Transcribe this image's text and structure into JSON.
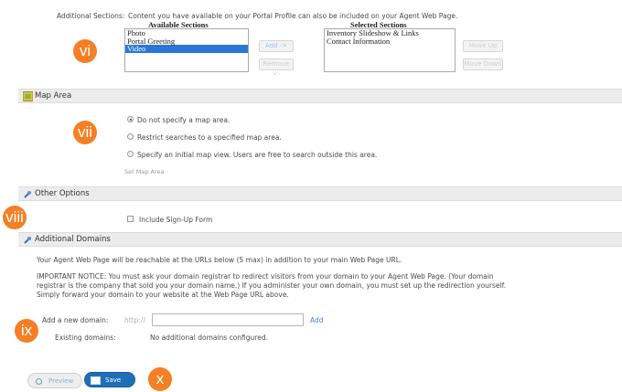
{
  "additional_sections": {
    "label": "Additional Sections:",
    "description": "Content you have available on your Portal Profile can also be included on your Agent Web Page.",
    "available_header": "Available Sections",
    "selected_header": "Selected Sections",
    "available_items": [
      "Photo",
      "Portal Greeting",
      "Video"
    ],
    "selected_items": [
      "Inventory Slideshow & Links",
      "Contact Information"
    ],
    "add_button": "Add ->",
    "remove_button": "Remove <-",
    "move_up_button": "Move Up",
    "move_down_button": "Move Down"
  },
  "map_area": {
    "title": "Map Area",
    "options": [
      "Do not specify a map area.",
      "Restrict searches to a specified map area.",
      "Specify an initial map view. Users are free to search outside this area."
    ],
    "selected_index": 0,
    "set_link": "Set Map Area"
  },
  "other_options": {
    "title": "Other Options",
    "signup_label": "Include Sign-Up Form"
  },
  "additional_domains": {
    "title": "Additional Domains",
    "intro": "Your Agent Web Page will be reachable at the URLs below (5 max) in addition to your main Web Page URL.",
    "notice_line1": "IMPORTANT NOTICE: You must ask your domain registrar to redirect visitors from your domain to your Agent Web Page. (Your domain",
    "notice_line2": "registrar is the company that sold you your domain name.) If you administer your own domain, you must set up the redirection yourself.",
    "notice_line3": "Simply forward your domain to your website at the Web Page URL above.",
    "add_label": "Add a new domain:",
    "prefix": "http://",
    "input_value": "",
    "add_link": "Add",
    "existing_label": "Existing domains:",
    "existing_value": "No additional domains configured."
  },
  "footer": {
    "preview": "Preview",
    "save": "Save"
  },
  "callouts": [
    "vi",
    "vii",
    "viii",
    "ix",
    "x"
  ],
  "colors": {
    "accent": "#f47f24",
    "link": "#4a86c7",
    "selected": "#2a78d6",
    "save_button": "#1f6fb8"
  }
}
